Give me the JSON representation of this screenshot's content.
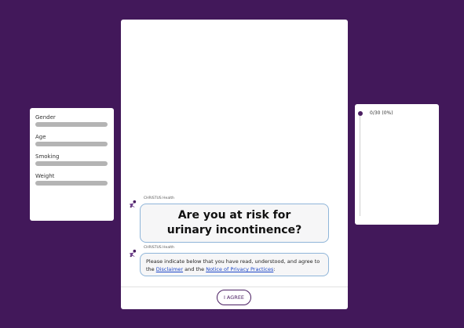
{
  "profile": {
    "fields": [
      {
        "label": "Gender"
      },
      {
        "label": "Age"
      },
      {
        "label": "Smoking"
      },
      {
        "label": "Weight"
      }
    ]
  },
  "chat": {
    "sender_name": "CHRISTUS Health",
    "title_message": "Are you at risk for urinary incontinence?",
    "consent": {
      "text_before": "Please  indicate below that you have read, understood, and agree to the ",
      "disclaimer_link": "Disclaimer",
      "text_middle": " and the ",
      "privacy_link": "Notice of Privacy Practices",
      "text_after": ":"
    },
    "agree_button": "I AGREE"
  },
  "progress": {
    "text": "0/30 (0%)",
    "fraction": 0
  },
  "colors": {
    "background": "#42185a",
    "accent": "#4b1f62",
    "link": "#1b46c7",
    "bubble_border": "#8fb5d9",
    "bar": "#b4b4b4"
  },
  "icons": {
    "bot_avatar": "christus-logo-icon",
    "progress_marker": "progress-dot-icon"
  }
}
